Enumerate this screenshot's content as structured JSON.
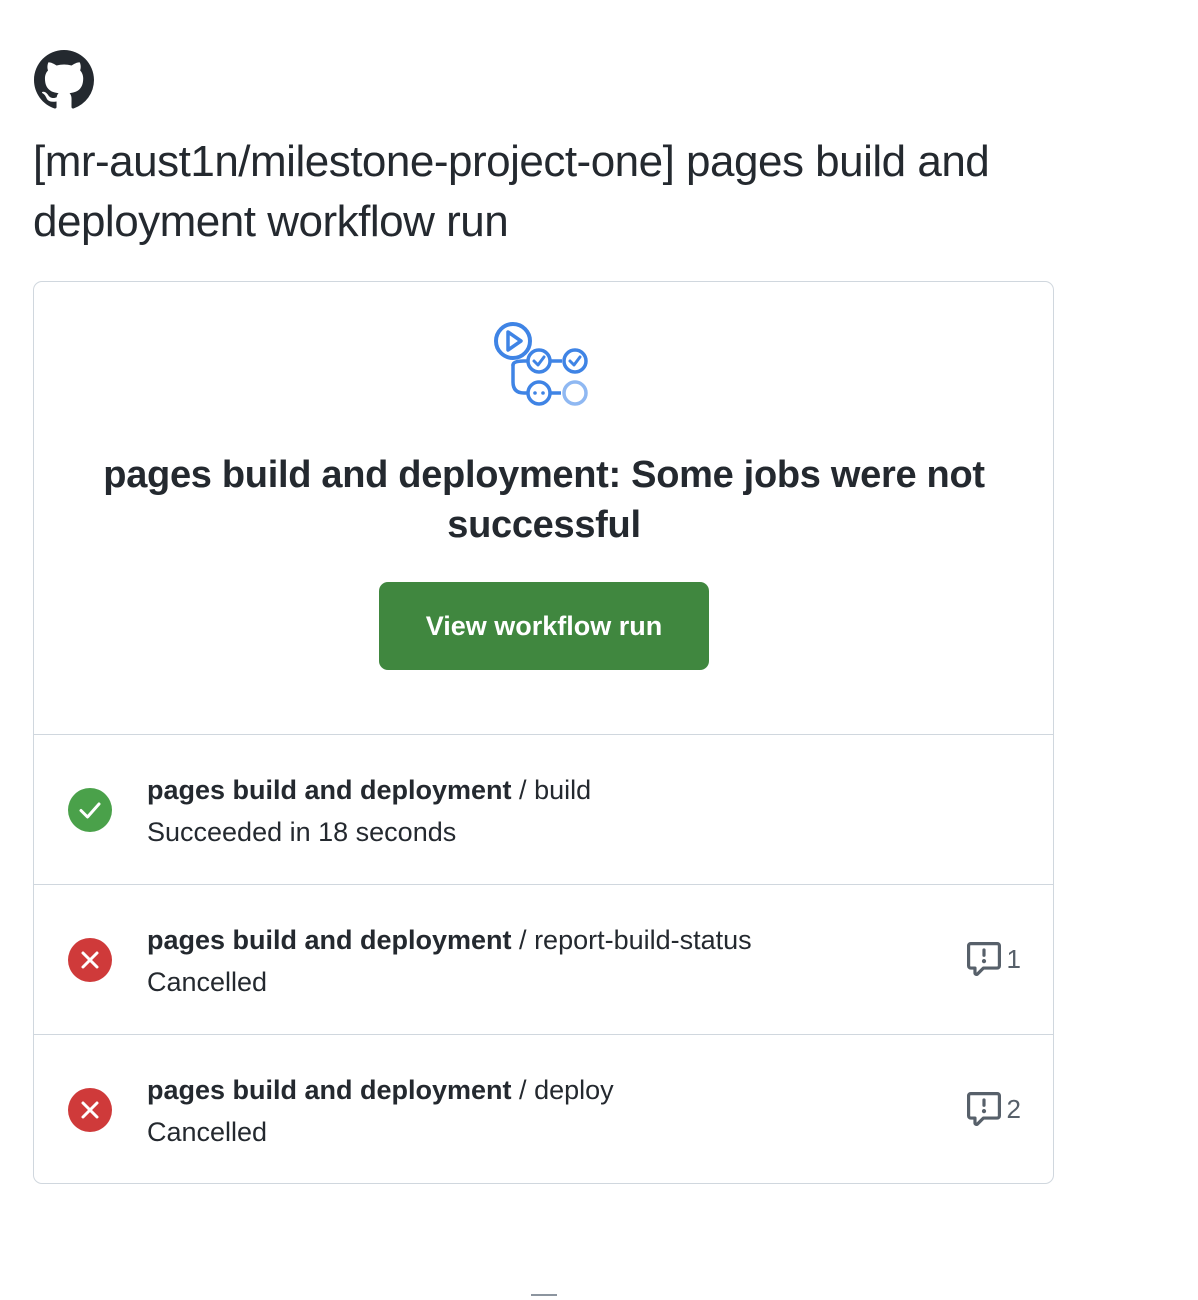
{
  "header": {
    "logo": "github-mark-icon",
    "title": "[mr-aust1n/milestone-project-one] pages build and deployment workflow run"
  },
  "hero": {
    "icon": "workflow-icon",
    "headline": "pages build and deployment: Some jobs were not successful",
    "button_label": "View workflow run",
    "button_color": "#40873f"
  },
  "jobs": [
    {
      "workflow": "pages build and deployment",
      "separator": " / ",
      "name": "build",
      "status": "Succeeded in 18 seconds",
      "result": "success",
      "icon": "check-circle-icon",
      "color": "#4aa14a"
    },
    {
      "workflow": "pages build and deployment",
      "separator": " / ",
      "name": "report-build-status",
      "status": "Cancelled",
      "result": "cancelled",
      "icon": "x-circle-icon",
      "color": "#cf3a3a",
      "annotations": "1",
      "annotation_icon": "comment-alert-icon"
    },
    {
      "workflow": "pages build and deployment",
      "separator": " / ",
      "name": "deploy",
      "status": "Cancelled",
      "result": "cancelled",
      "icon": "x-circle-icon",
      "color": "#cf3a3a",
      "annotations": "2",
      "annotation_icon": "comment-alert-icon"
    }
  ]
}
